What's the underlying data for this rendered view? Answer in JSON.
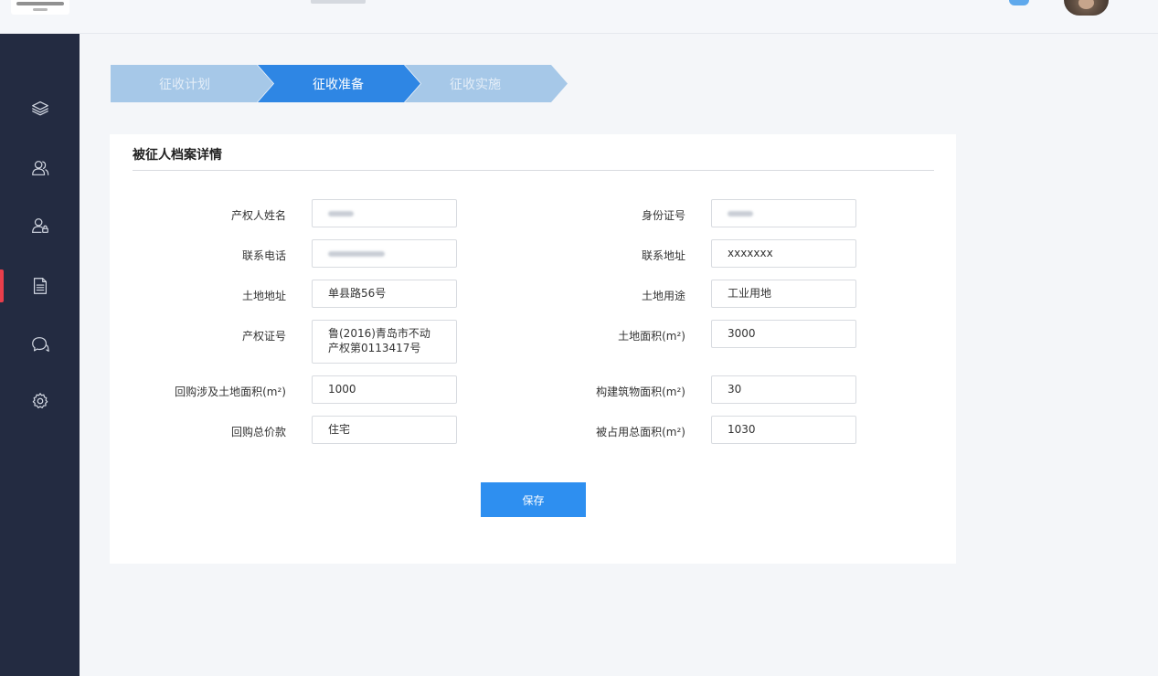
{
  "steps": [
    "征收计划",
    "征收准备",
    "征收实施"
  ],
  "card": {
    "title": "被征人档案详情"
  },
  "form": {
    "owner_name_label": "产权人姓名",
    "id_number_label": "身份证号",
    "phone_label": "联系电话",
    "contact_address_label": "联系地址",
    "contact_address_value": "xxxxxxx",
    "land_address_label": "土地地址",
    "land_address_value": "单县路56号",
    "land_use_label": "土地用途",
    "land_use_value": "工业用地",
    "cert_no_label": "产权证号",
    "cert_no_value": "鲁(2016)青岛市不动产权第0113417号",
    "land_area_label": "土地面积(m²)",
    "land_area_value": "3000",
    "buyback_land_area_label": "回购涉及土地面积(m²)",
    "buyback_land_area_value": "1000",
    "building_area_label": "构建筑物面积(m²)",
    "building_area_value": "30",
    "buyback_price_label": "回购总价款",
    "buyback_price_value": "住宅",
    "occupied_area_label": "被占用总面积(m²)",
    "occupied_area_value": "1030"
  },
  "save_label": "保存",
  "sidebar": {
    "icons": [
      "layers-icon",
      "users-icon",
      "user-lock-icon",
      "document-icon",
      "chat-icon",
      "settings-icon"
    ],
    "active": "document-icon"
  },
  "colors": {
    "sidebar_bg": "#232b41",
    "active_marker": "#e93e4b",
    "step_active": "#2e86e4",
    "step_inactive": "#a6c8e8",
    "primary_button": "#2e8ff0"
  }
}
